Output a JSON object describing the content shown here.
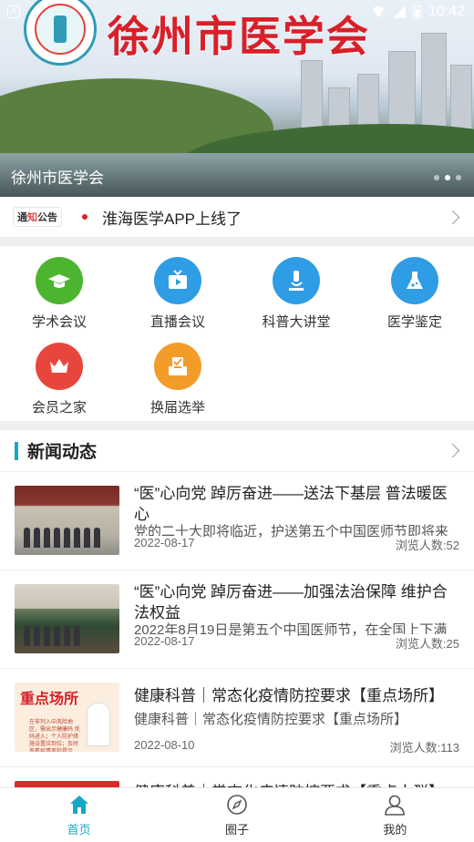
{
  "status_bar": {
    "time": "10:42"
  },
  "banner": {
    "title": "徐州市医学会",
    "caption": "徐州市医学会",
    "slide_count": 3,
    "active_slide": 2
  },
  "notice": {
    "badge_part1": "通",
    "badge_part2": "知",
    "badge_part3": "公告",
    "text": "淮海医学APP上线了"
  },
  "shortcuts": [
    {
      "label": "学术会议",
      "icon": "graduation-cap-icon",
      "color": "#4cb52f"
    },
    {
      "label": "直播会议",
      "icon": "tv-play-icon",
      "color": "#2f9ce6"
    },
    {
      "label": "科普大讲堂",
      "icon": "microscope-icon",
      "color": "#2f9ce6"
    },
    {
      "label": "医学鉴定",
      "icon": "flask-icon",
      "color": "#2f9ce6"
    },
    {
      "label": "会员之家",
      "icon": "crown-icon",
      "color": "#e8463c"
    },
    {
      "label": "换届选举",
      "icon": "ballot-box-icon",
      "color": "#f39c2a"
    }
  ],
  "news": {
    "title": "新闻动态",
    "items": [
      {
        "title": "“医”心向党 踔厉奋进——送法下基层 普法暖医心",
        "summary": "党的二十大即将临近，护送第五个中国医师节即将来",
        "date": "2022-08-17",
        "views": "浏览人数:52"
      },
      {
        "title": "“医”心向党 踔厉奋进——加强法治保障 维护合法权益",
        "summary": "2022年8月19日是第五个中国医师节，在全国上下满",
        "date": "2022-08-17",
        "views": "浏览人数:25"
      },
      {
        "title": "健康科普｜常态化疫情防控要求【重点场所】",
        "summary": "健康科普｜常态化疫情防控要求【重点场所】",
        "date": "2022-08-10",
        "views": "浏览人数:113",
        "thumb_text": "重点场所",
        "thumb_note": "在非列入中风险地区，需出示健康码 凭码进入；个人防护措施设置应到位；及时查看疫情风险提示"
      },
      {
        "title": "健康科普｜常态化疫情防控要求【重点人群】",
        "summary": "",
        "date": "",
        "views": ""
      }
    ]
  },
  "tabbar": [
    {
      "label": "首页",
      "icon": "home-icon",
      "active": true
    },
    {
      "label": "圈子",
      "icon": "compass-icon",
      "active": false
    },
    {
      "label": "我的",
      "icon": "user-icon",
      "active": false
    }
  ],
  "colors": {
    "accent": "#16a7c6",
    "red": "#d8202a"
  }
}
